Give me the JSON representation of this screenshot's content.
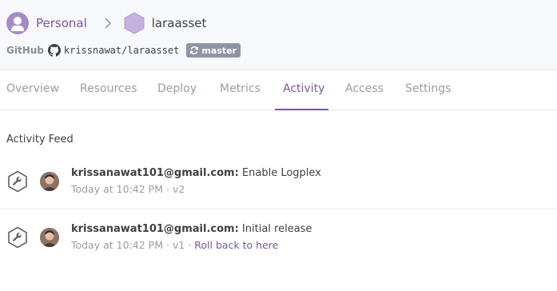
{
  "breadcrumb": {
    "owner": "Personal",
    "app": "laraasset"
  },
  "repo": {
    "label": "GitHub",
    "name": "krissnawat/laraasset",
    "branch": "master"
  },
  "tabs": [
    {
      "label": "Overview"
    },
    {
      "label": "Resources"
    },
    {
      "label": "Deploy"
    },
    {
      "label": "Metrics"
    },
    {
      "label": "Activity",
      "active": true
    },
    {
      "label": "Access"
    },
    {
      "label": "Settings"
    }
  ],
  "feed": {
    "title": "Activity Feed",
    "items": [
      {
        "user": "krissanawat101@gmail.com:",
        "action": "Enable Logplex",
        "time": "Today at 10:42 PM",
        "separator": "·",
        "version": "v2"
      },
      {
        "user": "krissanawat101@gmail.com:",
        "action": "Initial release",
        "time": "Today at 10:42 PM",
        "separator": "·",
        "version": "v1",
        "separator2": "·",
        "link": "Roll back to here"
      }
    ]
  },
  "colors": {
    "accent": "#79589f",
    "muted": "#9a9ca6",
    "text": "#3f3f44",
    "header_bg": "#f7f8fb",
    "branch_bg": "#8f94a4"
  },
  "icons": {
    "owner": "person-avatar-icon",
    "separator": "chevron-right-icon",
    "app": "hexagon-icon",
    "repo": "github-icon",
    "branch": "sync-icon",
    "feed_item": "wrench-icon"
  }
}
